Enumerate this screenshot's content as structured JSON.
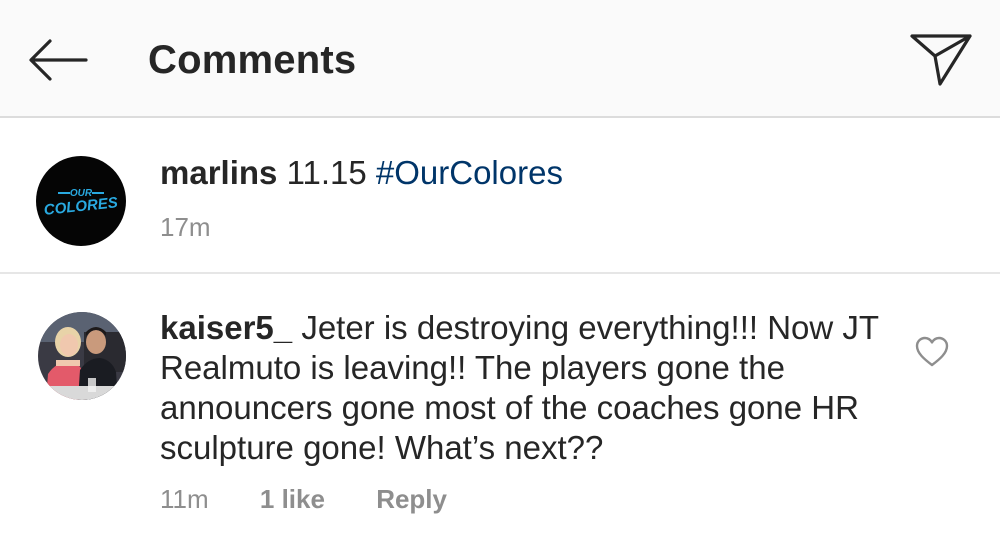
{
  "header": {
    "title": "Comments"
  },
  "caption": {
    "logo_text_small": "OUR",
    "logo_text_large": "COLORES",
    "username": "marlins",
    "text": "11.15",
    "hashtag": "#OurColores",
    "time": "17m"
  },
  "comment": {
    "username": "kaiser5_",
    "text": "Jeter is destroying everything!!! Now JT Realmuto is leaving!! The players gone the announcers gone most of the coaches gone HR sculpture gone! What’s next??",
    "time": "11m",
    "likes": "1 like",
    "reply_label": "Reply"
  },
  "colors": {
    "hashtag": "#003569",
    "logo_accent": "#29a9e0",
    "secondary_text": "#8e8e8e"
  },
  "icons": {
    "back": "arrow-left-icon",
    "send": "paper-plane-icon",
    "like": "heart-outline-icon"
  }
}
